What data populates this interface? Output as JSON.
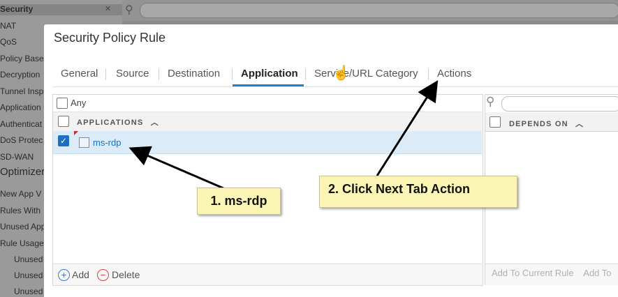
{
  "background": {
    "sidebar_items": [
      "Security",
      "NAT",
      "QoS",
      "Policy Base",
      "Decryption",
      "Tunnel Insp",
      "Application",
      "Authenticat",
      "DoS Protec",
      "SD-WAN",
      "Optimizer",
      "New App V",
      "Rules With",
      "Unused App",
      "Rule Usage",
      "Unused",
      "Unused",
      "Unused"
    ]
  },
  "dialog": {
    "title": "Security Policy Rule",
    "tabs": [
      "General",
      "Source",
      "Destination",
      "Application",
      "Service/URL Category",
      "Actions"
    ],
    "active_tab": "Application"
  },
  "applications_panel": {
    "any_label": "Any",
    "header": "APPLICATIONS",
    "rows": [
      {
        "name": "ms-rdp",
        "checked": true
      }
    ],
    "add_label": "Add",
    "delete_label": "Delete"
  },
  "depends_panel": {
    "header": "DEPENDS ON",
    "footer_text": "Add To Current Rule    Add To"
  },
  "annotations": {
    "callout_1": "1. ms-rdp",
    "callout_2": "2. Click Next Tab Action"
  },
  "colors": {
    "accent": "#1b82d1",
    "callout_bg": "#fbf6b5",
    "selected_row": "#dcebf8"
  }
}
